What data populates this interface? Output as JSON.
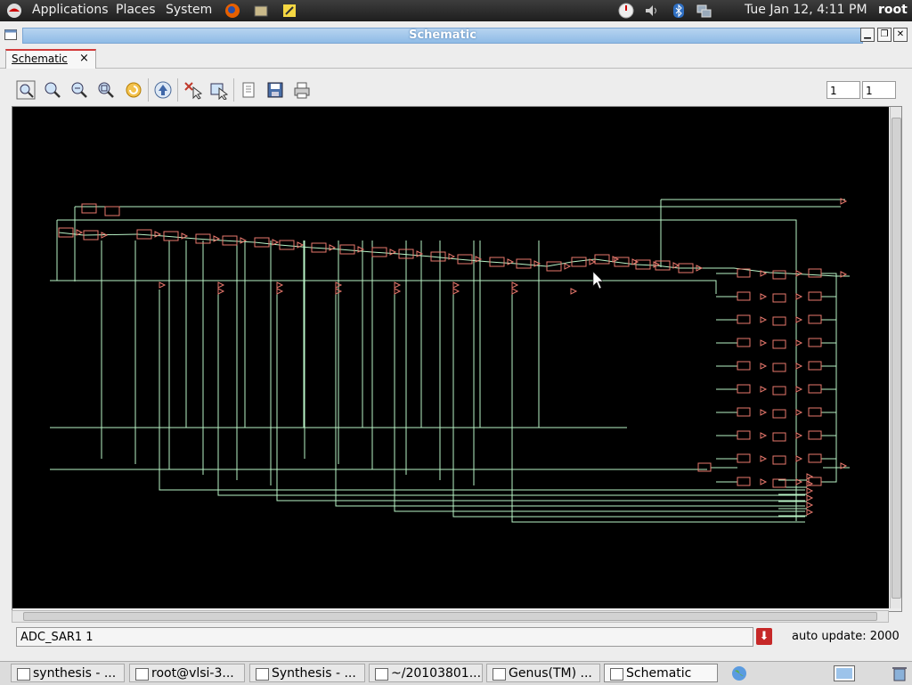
{
  "top_panel": {
    "menus": [
      "Applications",
      "Places",
      "System"
    ],
    "clock": "Tue Jan 12,  4:11 PM",
    "user": "root",
    "icons": [
      "redhat-logo-icon",
      "firefox-icon",
      "file-manager-icon",
      "notes-icon",
      "clock-icon",
      "volume-icon",
      "bluetooth-icon",
      "network-icon"
    ]
  },
  "window": {
    "title": "Schematic"
  },
  "tab": {
    "label": "Schematic",
    "close": "×"
  },
  "toolbar": {
    "tools": [
      "zoom-fit",
      "zoom-in",
      "zoom-out",
      "zoom-area",
      "refresh",
      "up-hierarchy",
      "deselect",
      "select-options",
      "properties",
      "save",
      "print"
    ],
    "page_value": "1",
    "page_total": "1"
  },
  "status": {
    "field_value": "ADC_SAR1 1",
    "save_glyph": "⬇",
    "auto_update": "auto update: 2000"
  },
  "taskbar": {
    "tasks": [
      "synthesis - ...",
      "root@vlsi-3...",
      "Synthesis - ...",
      "~/20103801...",
      "Genus(TM) ...",
      "Schematic"
    ]
  },
  "colors": {
    "wire": "#b9f3c6",
    "cell": "#e8786d",
    "title_blue": "#9cc3ea",
    "canvas": "#000000"
  }
}
